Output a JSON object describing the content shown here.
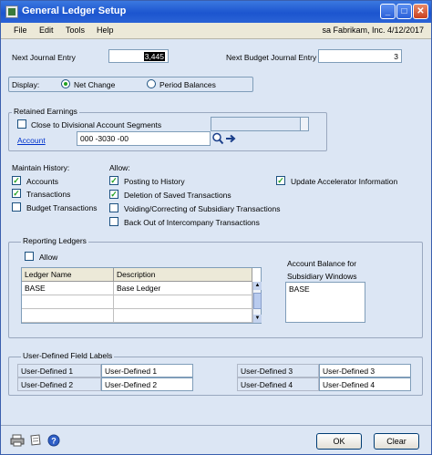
{
  "window": {
    "title": "General Ledger Setup",
    "minimize": "_",
    "maximize": "□",
    "close": "✕"
  },
  "menu": {
    "file": "File",
    "edit": "Edit",
    "tools": "Tools",
    "help": "Help",
    "user_info": "sa  Fabrikam, Inc.  4/12/2017"
  },
  "journal": {
    "next_journal_label": "Next Journal Entry",
    "next_journal_value": "3,445",
    "next_budget_label": "Next Budget Journal Entry",
    "next_budget_value": "3"
  },
  "display": {
    "label": "Display:",
    "net_change": "Net Change",
    "period_balances": "Period Balances",
    "selected": "Net Change"
  },
  "retained": {
    "title": "Retained Earnings",
    "close_divisional_label": "Close to Divisional Account Segments",
    "close_divisional_checked": false,
    "account_label": "Account",
    "account_value": "000 -3030 -00"
  },
  "history": {
    "title": "Maintain History:",
    "accounts": "Accounts",
    "accounts_checked": true,
    "transactions": "Transactions",
    "transactions_checked": true,
    "budget_transactions": "Budget Transactions",
    "budget_transactions_checked": false
  },
  "allow": {
    "title": "Allow:",
    "posting_history": "Posting to History",
    "posting_history_checked": true,
    "deletion_saved": "Deletion of Saved Transactions",
    "deletion_saved_checked": true,
    "voiding": "Voiding/Correcting of Subsidiary Transactions",
    "voiding_checked": false,
    "back_out": "Back Out of Intercompany Transactions",
    "back_out_checked": false,
    "update_accelerator": "Update Accelerator Information",
    "update_accelerator_checked": true
  },
  "reporting": {
    "title": "Reporting Ledgers",
    "allow_label": "Allow",
    "allow_checked": false,
    "col_name": "Ledger Name",
    "col_description": "Description",
    "rows": [
      {
        "name": "BASE",
        "description": "Base Ledger"
      },
      {
        "name": "",
        "description": ""
      },
      {
        "name": "",
        "description": ""
      }
    ],
    "balance_label_1": "Account Balance for",
    "balance_label_2": "Subsidiary Windows",
    "balance_value": "BASE"
  },
  "udf": {
    "title": "User-Defined Field Labels",
    "l1": "User-Defined 1",
    "v1": "User-Defined 1",
    "l2": "User-Defined 2",
    "v2": "User-Defined 2",
    "l3": "User-Defined 3",
    "v3": "User-Defined 3",
    "l4": "User-Defined 4",
    "v4": "User-Defined 4"
  },
  "buttons": {
    "ok": "OK",
    "clear": "Clear"
  },
  "colors": {
    "titlebar": "#1c55cf",
    "check_green": "#21a121",
    "link": "#0033cc"
  }
}
